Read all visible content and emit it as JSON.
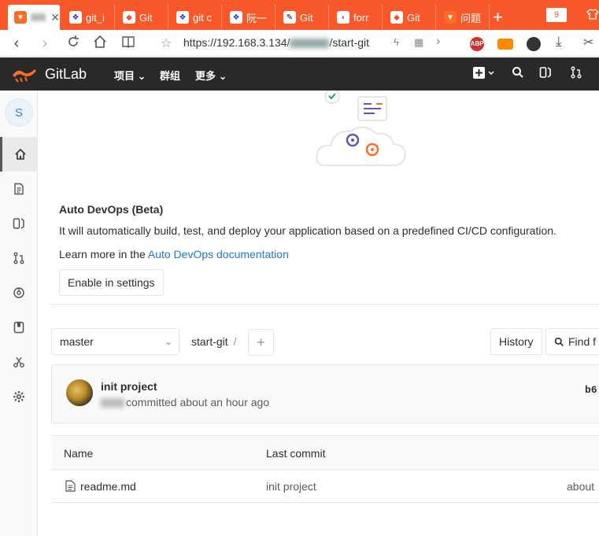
{
  "browser": {
    "tabs": [
      {
        "label": "",
        "icon": "gitlab-icon",
        "active": true
      },
      {
        "label": "git_i",
        "icon": "baidu-paw-icon"
      },
      {
        "label": "Git",
        "icon": "git-icon"
      },
      {
        "label": "git c",
        "icon": "baidu-paw-icon"
      },
      {
        "label": "阮一",
        "icon": "baidu-paw-icon"
      },
      {
        "label": "Git",
        "icon": "blog-icon"
      },
      {
        "label": "forr",
        "icon": "orange-icon"
      },
      {
        "label": "Git",
        "icon": "git-icon"
      },
      {
        "label": "问题",
        "icon": "gitlab-icon"
      }
    ],
    "tab_count": "9",
    "url_prefix": "https://192.168.3.134/",
    "url_suffix": "/start-git",
    "ext_abp": "ABP"
  },
  "gitlab": {
    "brand": "GitLab",
    "menu": {
      "projects": "项目",
      "groups": "群组",
      "more": "更多"
    }
  },
  "sidebar": {
    "avatar_letter": "S",
    "items": [
      "home-icon",
      "file-icon",
      "issues-icon",
      "merge-request-icon",
      "pipeline-icon",
      "wiki-icon",
      "snippets-icon",
      "settings-icon"
    ]
  },
  "devops": {
    "title": "Auto DevOps (Beta)",
    "description": "It will automatically build, test, and deploy your application based on a predefined CI/CD configuration.",
    "learn_prefix": "Learn more in the ",
    "learn_link": "Auto DevOps documentation",
    "enable_button": "Enable in settings"
  },
  "repo": {
    "branch": "master",
    "path": "start-git",
    "path_sep": "/",
    "history_button": "History",
    "find_button": "Find f"
  },
  "commit": {
    "title": "init project",
    "meta": "committed about an hour ago",
    "sha": "b6"
  },
  "tree": {
    "headers": {
      "name": "Name",
      "last_commit": "Last commit"
    },
    "rows": [
      {
        "name": "readme.md",
        "last_commit": "init project",
        "updated": "about"
      }
    ]
  },
  "colors": {
    "browser_accent": "#f8582a",
    "gitlab_nav": "#292929",
    "link": "#1f78d1"
  }
}
